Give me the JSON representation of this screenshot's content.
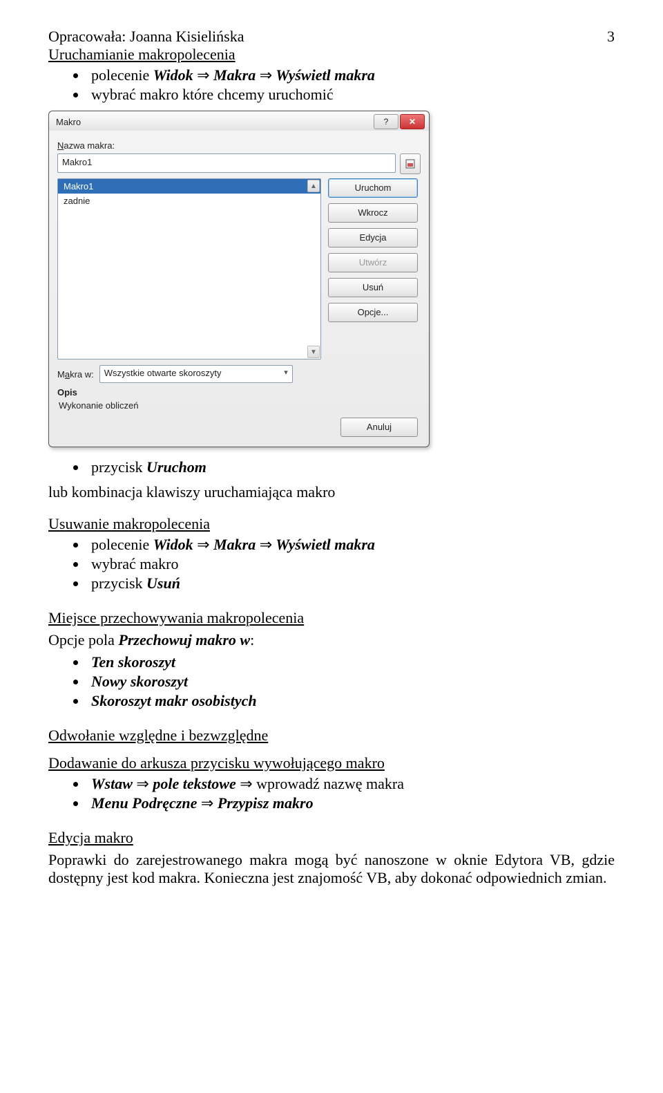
{
  "header": {
    "author": "Opracowała: Joanna Kisielińska",
    "page_number": "3"
  },
  "sections": {
    "run": {
      "title": "Uruchamianie makropolecenia",
      "bullet1_a": "polecenie ",
      "bullet1_b": "Widok ",
      "bullet1_arrow": "⇒",
      "bullet1_c": " Makra ",
      "bullet1_d": " Wyświetl makra",
      "bullet2": "wybrać makro które chcemy uruchomić",
      "bullet3_a": "przycisk ",
      "bullet3_b": "Uruchom",
      "after": "lub kombinacja klawiszy uruchamiająca makro"
    },
    "delete": {
      "title": "Usuwanie makropolecenia",
      "b1_a": "polecenie ",
      "b1_b": "Widok ",
      "b1_ar": "⇒",
      "b1_c": " Makra ",
      "b1_d": " Wyświetl makra",
      "b2": "wybrać makro",
      "b3_a": "przycisk ",
      "b3_b": "Usuń"
    },
    "storage": {
      "title": "Miejsce przechowywania makropolecenia",
      "lead_a": "Opcje pola ",
      "lead_b": "Przechowuj makro w",
      "lead_c": ":",
      "i1": "Ten skoroszyt",
      "i2": "Nowy skoroszyt",
      "i3": "Skoroszyt makr osobistych"
    },
    "ref": {
      "title": "Odwołanie względne i bezwzględne"
    },
    "add": {
      "title": "Dodawanie do arkusza przycisku wywołującego makro",
      "b1_a": "Wstaw ",
      "b1_ar": "⇒",
      "b1_b": " pole tekstowe  ",
      "b1_c": " wprowadź nazwę makra",
      "b2_a": "Menu Podręczne ",
      "b2_ar": "⇒",
      "b2_b": " Przypisz makro"
    },
    "edit": {
      "title": "Edycja makro",
      "para": "Poprawki do zarejestrowanego makra mogą być nanoszone w oknie Edytora VB, gdzie dostępny jest kod makra. Konieczna jest znajomość VB, aby dokonać odpowiednich zmian."
    }
  },
  "dialog": {
    "title": "Makro",
    "name_label": "Nazwa makra:",
    "name_value": "Makro1",
    "list": [
      "Makro1",
      "zadnie"
    ],
    "buttons": {
      "run": "Uruchom",
      "step": "Wkrocz",
      "edit": "Edycja",
      "create": "Utwórz",
      "delete": "Usuń",
      "options": "Opcje...",
      "cancel": "Anuluj"
    },
    "scope_label": "Makra w:",
    "scope_value": "Wszystkie otwarte skoroszyty",
    "desc_label": "Opis",
    "desc_value": "Wykonanie obliczeń"
  }
}
